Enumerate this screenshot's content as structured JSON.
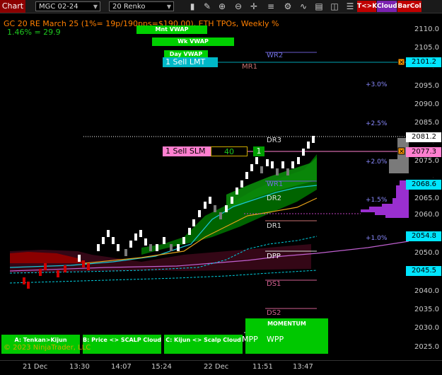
{
  "toolbar": {
    "chart_tab": "Chart",
    "instrument": "MGC 02-24",
    "bar_type": "20 Renko",
    "tk_button": "T<>K",
    "cloud_button": "Cloud",
    "barcol_button": "BarCol"
  },
  "header": {
    "title": "GC 20 RE March 25 (1%= 19p/190pps=$190.00), ETH TPOs, Weekly %",
    "subtitle": "1.46% = 29.9"
  },
  "vwap_labels": {
    "mnt": "Mnt VWAP",
    "wk": "Wk VWAP",
    "day": "Day VWAP"
  },
  "orders": {
    "sell_lmt": "1 Sell LMT",
    "sell_slm": "1 Sell SLM",
    "qty": "40",
    "count": "1"
  },
  "levels": {
    "wr2": "WR2",
    "mr1": "MR1",
    "dr3": "DR3",
    "wr1": "WR1",
    "dr2": "DR2",
    "dr1": "DR1",
    "dpp": "DPP",
    "ds1": "DS1",
    "ds2": "DS2",
    "mpp": "MPP",
    "wpp": "WPP"
  },
  "percent_labels": [
    "+3.0%",
    "+2.5%",
    "+2.0%",
    "+1.5%",
    "+1.0%"
  ],
  "price_axis": {
    "ticks": [
      "2110.0",
      "2105.0",
      "2100.0",
      "2095.0",
      "2090.0",
      "2085.0",
      "2080.0",
      "2075.0",
      "2070.0",
      "2065.0",
      "2060.0",
      "2055.0",
      "2050.0",
      "2045.0",
      "2040.0",
      "2035.0",
      "2030.0",
      "2025.0"
    ],
    "tag_2101": "2101.2",
    "tag_2081": "2081.2",
    "tag_2077": "2077.3",
    "tag_2068": "2068.6",
    "tag_2054": "2054.8",
    "tag_2045": "2045.5",
    "colors": {
      "lmt": "#00e5ff",
      "last": "#ffffff",
      "slm": "#ff7fd0",
      "wr1": "#00e5ff",
      "dpp": "#00e5ff"
    }
  },
  "time_axis": [
    "21 Dec",
    "13:30",
    "14:07",
    "15:24",
    "22 Dec",
    "11:51",
    "13:47"
  ],
  "bottom_buttons": {
    "a": "A: Tenkan>Kijun",
    "b": "B: Price <> SCALP Cloud",
    "c": "C: Kijun <> Scalp Cloud",
    "momentum": "MOMENTUM"
  },
  "copyright": "© 2023 NinjaTrader, LLC"
}
